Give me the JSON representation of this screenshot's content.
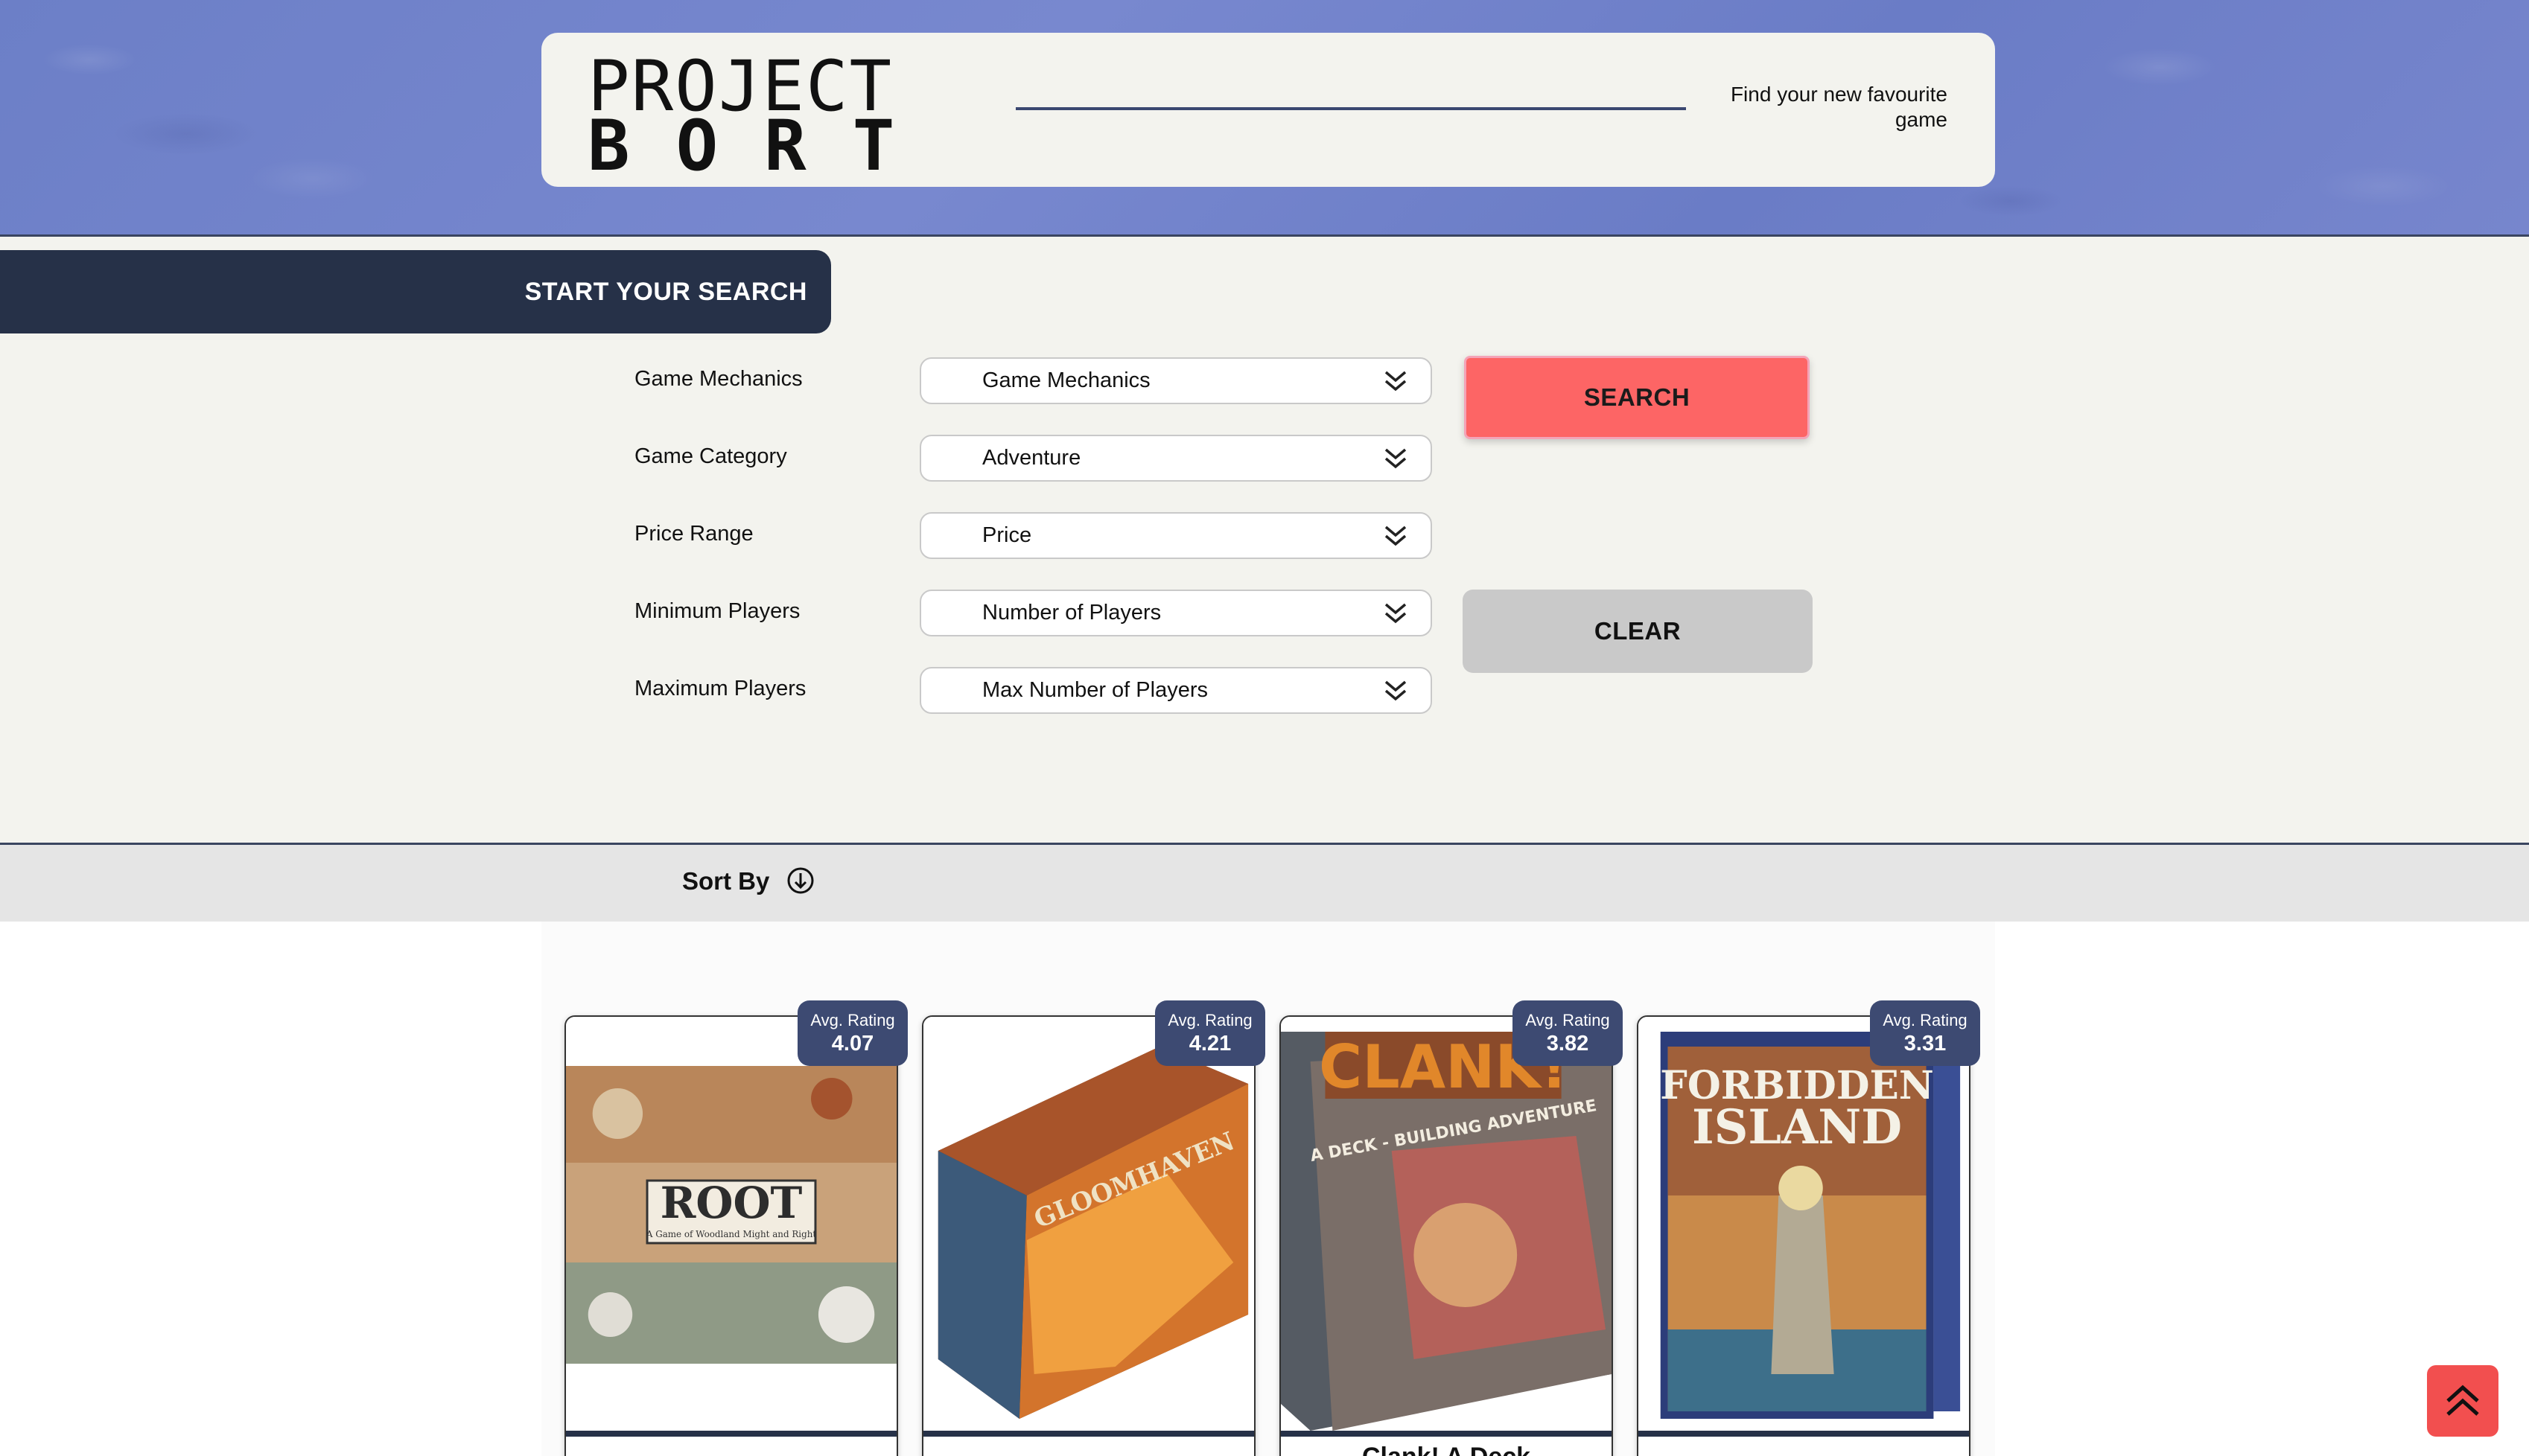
{
  "header": {
    "logo_top": "PROJECT",
    "logo_bottom": "BORT",
    "tagline": "Find your new favourite game"
  },
  "search": {
    "tab_title": "START YOUR SEARCH",
    "filters": [
      {
        "label": "Game Mechanics",
        "value": "Game Mechanics"
      },
      {
        "label": "Game Category",
        "value": "Adventure"
      },
      {
        "label": "Price Range",
        "value": "Price"
      },
      {
        "label": "Minimum Players",
        "value": "Number of Players"
      },
      {
        "label": "Maximum Players",
        "value": "Max Number of Players"
      }
    ],
    "search_button": "SEARCH",
    "clear_button": "CLEAR"
  },
  "sort": {
    "label": "Sort By",
    "icon": "sort-order-icon"
  },
  "results": {
    "rating_label": "Avg. Rating",
    "cards": [
      {
        "title": "",
        "box_title": "ROOT",
        "box_subtitle": "A Game of Woodland Might and Right",
        "rating": "4.07"
      },
      {
        "title": "",
        "box_title": "GLOOMHAVEN",
        "rating": "4.21"
      },
      {
        "title": "Clank! A Deck",
        "box_title": "CLANK!",
        "box_subtitle": "A DECK - BUILDING ADVENTURE",
        "rating": "3.82"
      },
      {
        "title": "",
        "box_title": "FORBIDDEN ISLAND",
        "rating": "3.31"
      }
    ]
  },
  "scroll_top": {
    "icon": "double-chevron-up-icon"
  },
  "colors": {
    "navy": "#263148",
    "search_red": "#fd6565",
    "clear_grey": "#c9c9c9",
    "rating_badge": "#3d4a72",
    "band_blue": "#7286cc"
  }
}
